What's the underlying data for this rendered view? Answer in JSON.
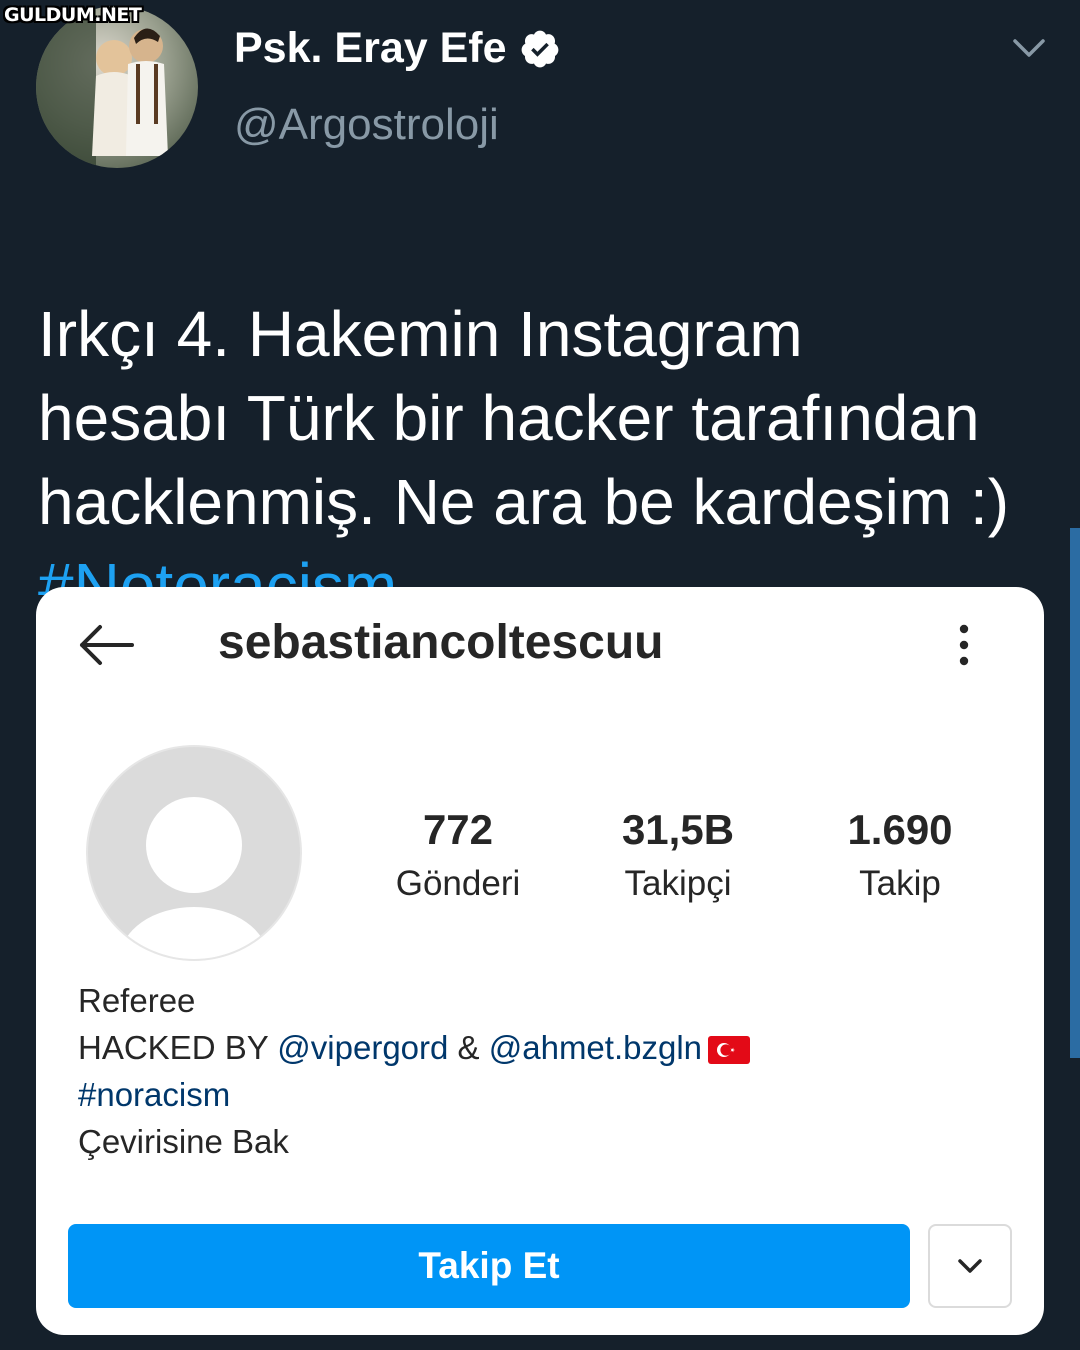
{
  "watermark": "GULDUM.NET",
  "tweet": {
    "author_name": "Psk. Eray Efe",
    "author_handle": "@Argostroloji",
    "text": "Irkçı 4. Hakemin Instagram\nhesabı Türk bir hacker tarafından\nhacklenmiş. Ne ara be kardeşim :)",
    "hashtag": "#Notoracism",
    "icons": {
      "verified": "verified-badge-icon",
      "menu": "chevron-down-icon"
    }
  },
  "instagram": {
    "username": "sebastiancoltescuu",
    "stats": [
      {
        "value": "772",
        "label": "Gönderi"
      },
      {
        "value": "31,5B",
        "label": "Takipçi"
      },
      {
        "value": "1.690",
        "label": "Takip"
      }
    ],
    "bio": {
      "line1": "Referee",
      "hacked_prefix": "HACKED BY ",
      "mention1": "@vipergord",
      "amp": " & ",
      "mention2": "@ahmet.bzgln",
      "hashtag": "#noracism",
      "translate": "Çevirisine Bak"
    },
    "follow_label": "Takip Et",
    "colors": {
      "follow_button": "#0095f6",
      "link": "#00376b"
    }
  },
  "colors": {
    "background": "#15202b",
    "hashtag": "#1da1f2",
    "handle": "#8899a6"
  }
}
